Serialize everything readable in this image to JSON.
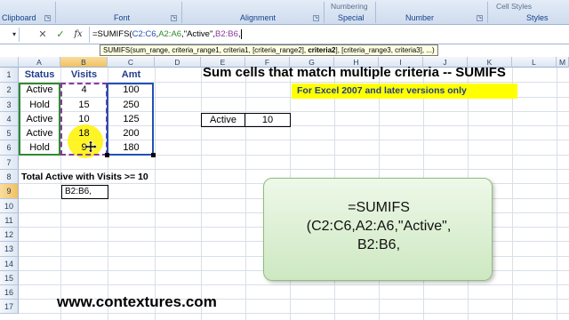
{
  "ribbon": {
    "groups": [
      "Clipboard",
      "Font",
      "Alignment",
      "Special",
      "Number",
      "Styles"
    ],
    "special_top": "Numbering",
    "styles_top": "Cell Styles"
  },
  "formula_bar": {
    "formula_prefix": "=SUMIFS(",
    "ref1": "C2:C6",
    "ref2": "A2:A6",
    "crit": "\"Active\"",
    "ref3": "B2:B6",
    "name_box": ""
  },
  "tooltip": {
    "prefix": "SUMIFS(sum_range, criteria_range1, criteria1, [criteria_range2], ",
    "bold": "criteria2",
    "suffix": "], [criteria_range3, criteria3], ...)"
  },
  "columns": [
    "A",
    "B",
    "C",
    "D",
    "E",
    "F",
    "G",
    "H",
    "I",
    "J",
    "K",
    "L",
    "M"
  ],
  "rows": [
    "1",
    "2",
    "3",
    "4",
    "5",
    "6",
    "7",
    "8",
    "9",
    "10",
    "11",
    "12",
    "13",
    "14",
    "15",
    "16",
    "17"
  ],
  "table": {
    "headers": [
      "Status",
      "Visits",
      "Amt"
    ],
    "data": [
      [
        "Active",
        "4",
        "100"
      ],
      [
        "Hold",
        "15",
        "250"
      ],
      [
        "Active",
        "10",
        "125"
      ],
      [
        "Active",
        "18",
        "200"
      ],
      [
        "Hold",
        "9",
        "180"
      ]
    ]
  },
  "title": "Sum cells that match multiple criteria -- SUMIFS",
  "note": "For Excel 2007 and later versions only",
  "criteria": {
    "status": "Active",
    "visits": "10"
  },
  "summary_label": "Total Active with Visits >= 10",
  "editing_cell": "B2:B6,",
  "callout": {
    "line1": "=SUMIFS",
    "line2": "(C2:C6,A2:A6,\"Active\",",
    "line3": "B2:B6,"
  },
  "footer": "www.contextures.com",
  "colors": {
    "ref1": "#2151b5",
    "ref2": "#2e8b2e",
    "ref3": "#8b3a9b",
    "highlight": "#ffff00"
  }
}
